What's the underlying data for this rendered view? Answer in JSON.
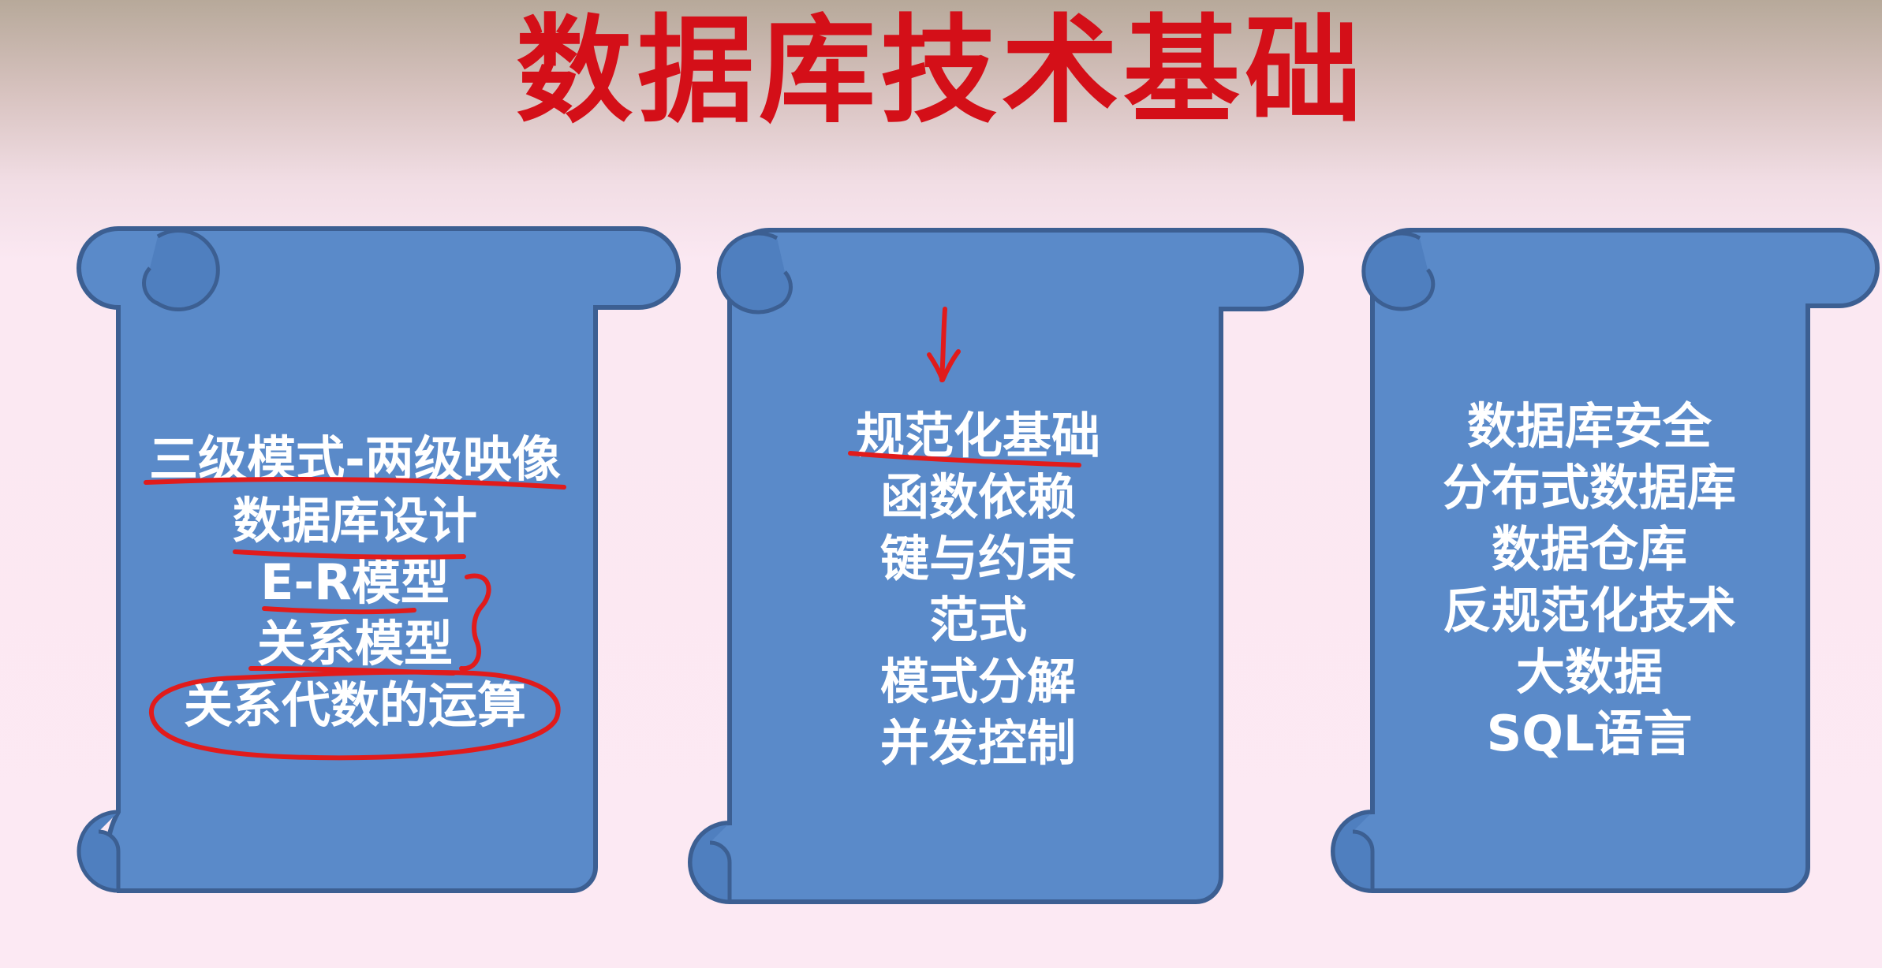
{
  "slide": {
    "title": "数据库技术基础",
    "colors": {
      "title": "#d40f18",
      "scroll_fill": "#5a8ac9",
      "scroll_stroke": "#3c5f92",
      "item_text": "#ffffff",
      "annotation_ink": "#e11b1b"
    },
    "panels": [
      {
        "items": [
          "三级模式-两级映像",
          "数据库设计",
          "E-R模型",
          "关系模型",
          "关系代数的运算"
        ]
      },
      {
        "items": [
          "规范化基础",
          "函数依赖",
          "键与约束",
          "范式",
          "模式分解",
          "并发控制"
        ]
      },
      {
        "items": [
          "数据库安全",
          "分布式数据库",
          "数据仓库",
          "反规范化技术",
          "大数据",
          "SQL语言"
        ]
      }
    ]
  }
}
